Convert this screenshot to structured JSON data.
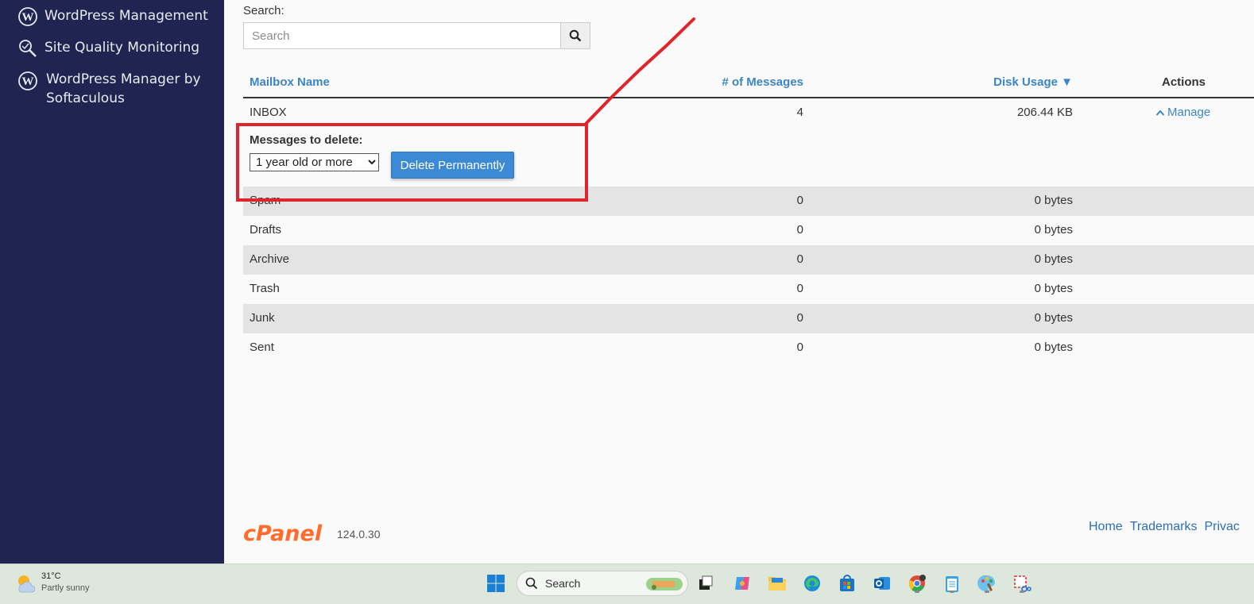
{
  "sidebar": {
    "items": [
      {
        "label": "WordPress Management",
        "icon": "wordpress-icon"
      },
      {
        "label": "Site Quality Monitoring",
        "icon": "magnifier-icon"
      },
      {
        "label": "WordPress Manager by",
        "label2": "Softaculous",
        "icon": "wordpress-icon"
      }
    ]
  },
  "search": {
    "label": "Search:",
    "placeholder": "Search"
  },
  "table": {
    "columns": {
      "name": "Mailbox Name",
      "messages": "# of Messages",
      "disk": "Disk Usage ▼",
      "actions": "Actions"
    },
    "inbox": {
      "name": "INBOX",
      "messages": "4",
      "disk": "206.44 KB",
      "action": "Manage"
    },
    "expand": {
      "label": "Messages to delete:",
      "select_value": "1 year old or more",
      "button": "Delete Permanently"
    },
    "rows": [
      {
        "name": "Spam",
        "messages": "0",
        "disk": "0 bytes"
      },
      {
        "name": "Drafts",
        "messages": "0",
        "disk": "0 bytes"
      },
      {
        "name": "Archive",
        "messages": "0",
        "disk": "0 bytes"
      },
      {
        "name": "Trash",
        "messages": "0",
        "disk": "0 bytes"
      },
      {
        "name": "Junk",
        "messages": "0",
        "disk": "0 bytes"
      },
      {
        "name": "Sent",
        "messages": "0",
        "disk": "0 bytes"
      }
    ]
  },
  "footer": {
    "logo": "cPanel",
    "version": "124.0.30",
    "links": [
      "Home",
      "Trademarks",
      "Privac"
    ]
  },
  "taskbar": {
    "weather_temp": "31°C",
    "weather_desc": "Partly sunny",
    "search_label": "Search"
  },
  "colors": {
    "sidebar": "#1f2450",
    "link": "#3c85c4",
    "button": "#3c8ad6",
    "annotation": "#e0242b",
    "logo": "#ff6c2c"
  }
}
